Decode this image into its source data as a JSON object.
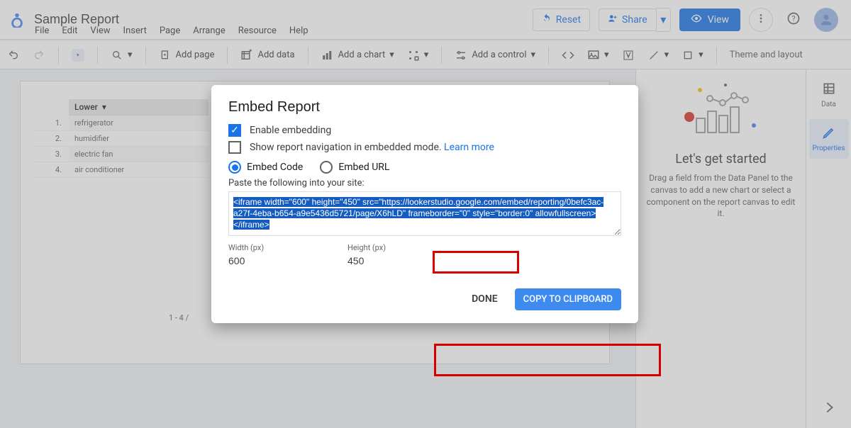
{
  "header": {
    "title": "Sample Report",
    "menus": [
      "File",
      "Edit",
      "View",
      "Insert",
      "Page",
      "Arrange",
      "Resource",
      "Help"
    ],
    "reset_label": "Reset",
    "share_label": "Share",
    "view_label": "View"
  },
  "toolbar": {
    "add_page": "Add page",
    "add_data": "Add data",
    "add_chart": "Add a chart",
    "add_control": "Add a control",
    "theme": "Theme and layout"
  },
  "table": {
    "header_label": "Lower",
    "rows": [
      {
        "idx": "1.",
        "value": "refrigerator"
      },
      {
        "idx": "2.",
        "value": "humidifier"
      },
      {
        "idx": "3.",
        "value": "electric fan"
      },
      {
        "idx": "4.",
        "value": "air conditioner"
      }
    ],
    "pagination": "1 - 4 /"
  },
  "right_panel": {
    "title": "Let's get started",
    "desc": "Drag a field from the Data Panel to the canvas to add a new chart or select a component on the report canvas to edit it."
  },
  "side_tabs": {
    "data": "Data",
    "properties": "Properties"
  },
  "modal": {
    "title": "Embed Report",
    "enable_label": "Enable embedding",
    "show_nav_label": "Show report navigation in embedded mode.",
    "learn_more": "Learn more",
    "radio_code": "Embed Code",
    "radio_url": "Embed URL",
    "paste_hint": "Paste the following into your site:",
    "code": "<iframe width=\"600\" height=\"450\" src=\"https://lookerstudio.google.com/embed/reporting/0befc3ac-a27f-4eba-b654-a9e5436d5721/page/X6hLD\" frameborder=\"0\" style=\"border:0\" allowfullscreen></iframe>",
    "width_label": "Width (px)",
    "height_label": "Height (px)",
    "width_value": "600",
    "height_value": "450",
    "done": "DONE",
    "copy": "COPY TO CLIPBOARD"
  }
}
